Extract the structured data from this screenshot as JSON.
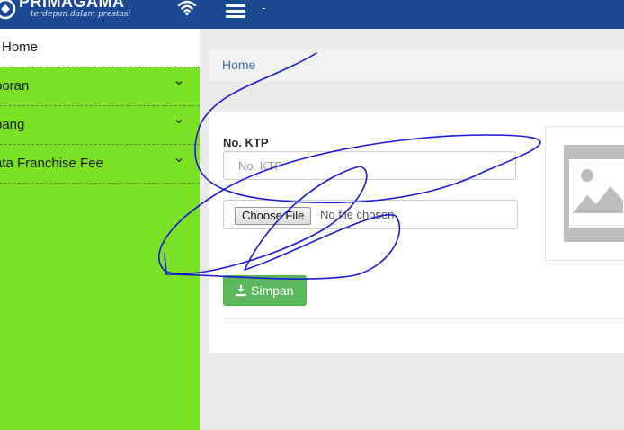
{
  "header": {
    "brand_name": "PRIMAGAMA",
    "brand_tagline": "terdepan dalam prestasi",
    "title_text": "-"
  },
  "sidebar": {
    "items": [
      {
        "label": "Home",
        "active": true
      },
      {
        "label": "poran",
        "active": false
      },
      {
        "label": "bang",
        "active": false
      },
      {
        "label": "ata Franchise Fee",
        "active": false
      }
    ]
  },
  "breadcrumb": {
    "home": "Home"
  },
  "form": {
    "ktp_label": "No. KTP",
    "ktp_placeholder": "No. KTP",
    "ktp_value": "",
    "file_button": "Choose File",
    "file_status": "No file chosen",
    "save_label": "Simpan"
  },
  "colors": {
    "topbar": "#1b4a93",
    "sidebar": "#7ae124",
    "save_button": "#5cb85c",
    "ink_scribble": "#1a1ad6"
  },
  "icons": {
    "wifi": "wifi-icon",
    "menu": "hamburger-icon",
    "chevron": "chevron-down-icon",
    "download": "download-icon",
    "placeholder": "image-placeholder-icon"
  }
}
